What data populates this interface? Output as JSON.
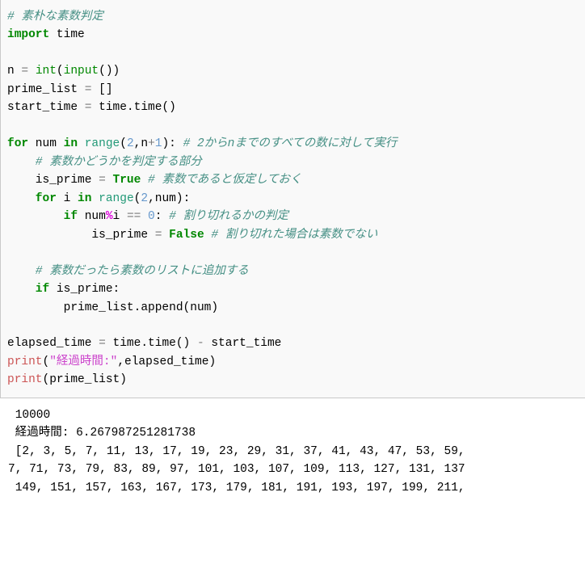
{
  "code": {
    "c1": "# 素朴な素数判定",
    "kw_import": "import",
    "mod_time": " time",
    "n": "n ",
    "eq": "=",
    "sp": " ",
    "int": "int",
    "lp": "(",
    "input": "input",
    "rp2": "())",
    "prime_list": "prime_list ",
    "empty": " []",
    "start_time": "start_time ",
    "timetime": " time.time()",
    "for1": "for",
    "num": " num ",
    "in": "in",
    "range": " range",
    "args1": "(",
    "two": "2",
    "comma": ",",
    "n2": "n",
    "plus": "+",
    "one": "1",
    "rp": "):",
    "c2": " # 2からnまでのすべての数に対して実行",
    "c3": "    # 素数かどうかを判定する部分",
    "isprime": "    is_prime ",
    "true": " True",
    "c4": " # 素数であると仮定しておく",
    "for2": "    for",
    "i": " i ",
    "args2": "(",
    "numv": "num",
    "rp3": "):",
    "if1": "        if",
    "nummod": " num",
    "pct": "%",
    "iv": "i ",
    "eqeq": "==",
    "zero": " 0",
    "colon": ":",
    "c5": " # 割り切れるかの判定",
    "isprime2": "            is_prime ",
    "false": " False",
    "c6": " # 割り切れた場合は素数でない",
    "c7": "    # 素数だったら素数のリストに追加する",
    "if2": "    if",
    "isprime3": " is_prime:",
    "append": "        prime_list.append(num)",
    "elapsed": "elapsed_time ",
    "minus": " time.time() ",
    "dash": "-",
    "st2": " start_time",
    "print1": "print",
    "str1": "\"経過時間:\"",
    "el2": ",elapsed_time)",
    "print2": "print",
    "pl2": "(prime_list)"
  },
  "output": {
    "l1": " 10000",
    "l2": " 経過時間: 6.267987251281738",
    "l3": " [2, 3, 5, 7, 11, 13, 17, 19, 23, 29, 31, 37, 41, 43, 47, 53, 59,",
    "l4": "7, 71, 73, 79, 83, 89, 97, 101, 103, 107, 109, 113, 127, 131, 137",
    "l5": " 149, 151, 157, 163, 167, 173, 179, 181, 191, 193, 197, 199, 211, "
  }
}
